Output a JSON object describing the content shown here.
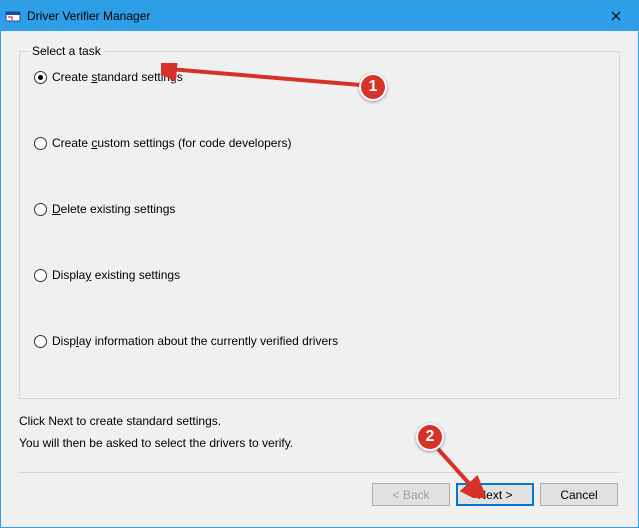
{
  "window": {
    "title": "Driver Verifier Manager"
  },
  "group": {
    "legend": "Select a task",
    "options": {
      "o0": {
        "pre": "Create ",
        "mn": "s",
        "post": "tandard settings",
        "selected": true
      },
      "o1": {
        "pre": "Create ",
        "mn": "c",
        "post": "ustom settings (for code developers)",
        "selected": false
      },
      "o2": {
        "pre": "",
        "mn": "D",
        "post": "elete existing settings",
        "selected": false
      },
      "o3": {
        "pre": "Displa",
        "mn": "y",
        "post": " existing settings",
        "selected": false
      },
      "o4": {
        "pre": "Disp",
        "mn": "l",
        "post": "ay information about the currently verified drivers",
        "selected": false
      }
    }
  },
  "info": {
    "line1": "Click Next to create standard settings.",
    "line2": "You will then be asked to select the drivers to verify."
  },
  "buttons": {
    "back": "< Back",
    "next": "Next >",
    "cancel": "Cancel"
  },
  "annotations": {
    "badge1": "1",
    "badge2": "2"
  }
}
